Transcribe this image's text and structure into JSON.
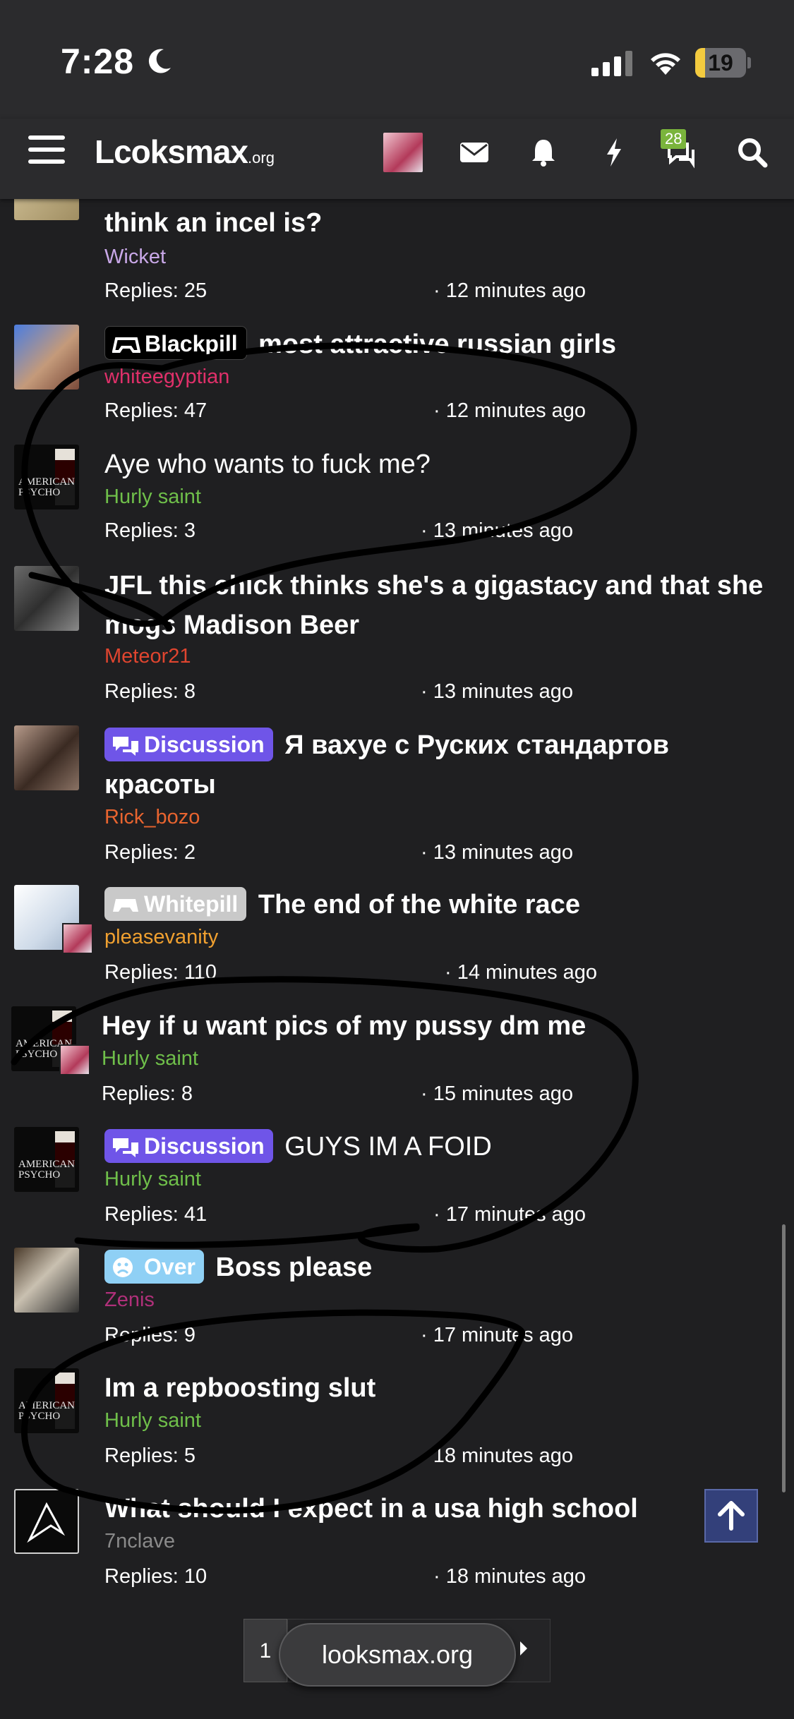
{
  "status_bar": {
    "time": "7:28",
    "battery": "19",
    "battery_level": 0.19
  },
  "nav": {
    "logo": "Lcoksmax",
    "logo_suffix": ".org",
    "conversations_badge": "28"
  },
  "threads": [
    {
      "title": "think an incel is?",
      "author": "Wicket",
      "author_color": "#c9a8e8",
      "replies": "Replies: 25",
      "ago": "· 12 minutes ago"
    },
    {
      "prefix": "Blackpill",
      "title": "most attractive russian girls",
      "author": "whiteegyptian",
      "author_color": "#e0306a",
      "replies": "Replies: 47",
      "ago": "· 12 minutes ago"
    },
    {
      "title": "Aye who wants to fuck me?",
      "author": "Hurly saint",
      "author_color": "#6fbf4a",
      "replies": "Replies: 3",
      "ago": "· 13 minutes ago"
    },
    {
      "title": "JFL this chick thinks she's a gigastacy and that she mogs Madison Beer",
      "author": "Meteor21",
      "author_color": "#e0452f",
      "replies": "Replies: 8",
      "ago": "· 13 minutes ago"
    },
    {
      "prefix": "Discussion",
      "title": "Я вахуе с Руских стандартов красоты",
      "author": "Rick_bozo",
      "author_color": "#e8642f",
      "replies": "Replies: 2",
      "ago": "· 13 minutes ago"
    },
    {
      "prefix": "Whitepill",
      "title": "The end of the white race",
      "author": "pleasevanity",
      "author_color": "#f0a030",
      "replies": "Replies: 110",
      "ago": "· 14 minutes ago"
    },
    {
      "title": "Hey if u want pics of my pussy dm me",
      "author": "Hurly saint",
      "author_color": "#6fbf4a",
      "replies": "Replies: 8",
      "ago": "· 15 minutes ago"
    },
    {
      "prefix": "Discussion",
      "title": "GUYS IM A FOID",
      "author": "Hurly saint",
      "author_color": "#6fbf4a",
      "replies": "Replies: 41",
      "ago": "· 17 minutes ago"
    },
    {
      "prefix": "Over",
      "title": "Boss please",
      "author": "Zenis",
      "author_color": "#b0307a",
      "replies": "Replies: 9",
      "ago": "· 17 minutes ago"
    },
    {
      "title": "Im a repboosting slut",
      "author": "Hurly saint",
      "author_color": "#6fbf4a",
      "replies": "Replies: 5",
      "ago": "· 18 minutes ago"
    },
    {
      "title": "What should I expect in a usa high school",
      "author": "7nclave",
      "author_color": "#8a8a8a",
      "replies": "Replies: 10",
      "ago": "· 18 minutes ago"
    }
  ],
  "avatar_labels": {
    "psycho": "AMERICAN PSYCHO"
  },
  "pager": {
    "current": "1"
  },
  "url_pill": "looksmax.org"
}
